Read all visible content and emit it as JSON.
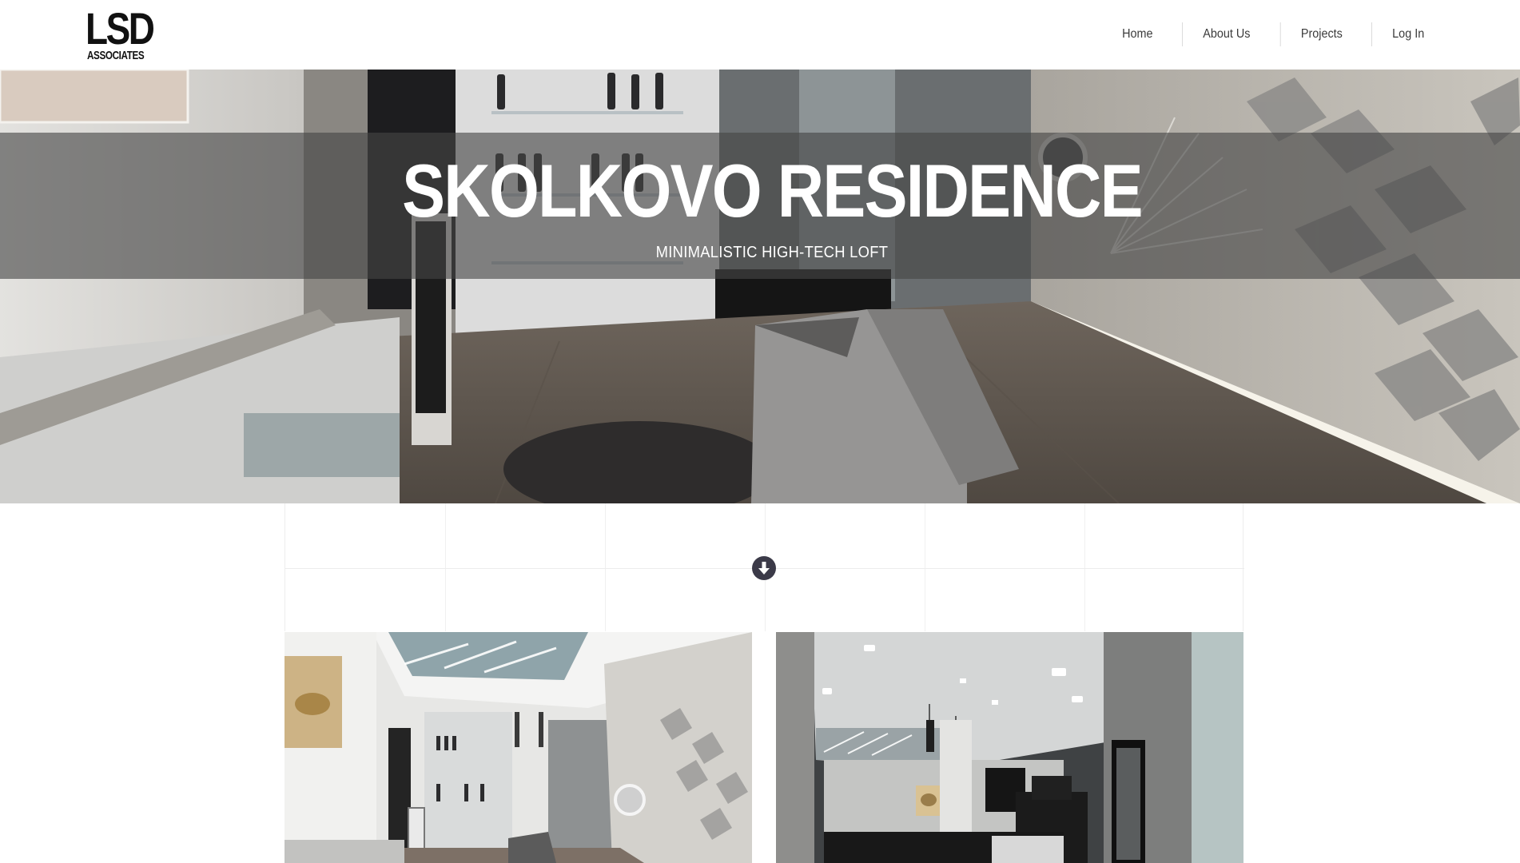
{
  "header": {
    "logo_main": "LSD",
    "logo_sub": "ASSOCIATES",
    "nav": [
      {
        "label": "Home"
      },
      {
        "label": "About Us"
      },
      {
        "label": "Projects"
      },
      {
        "label": "Log In"
      }
    ]
  },
  "hero": {
    "title": "SKOLKOVO RESIDENCE",
    "subtitle": "MINIMALISTIC HIGH-TECH LOFT"
  },
  "scroll": {
    "icon": "arrow-down-circle-icon"
  },
  "gallery": [
    {
      "icon": "interior-living-room-image"
    },
    {
      "icon": "interior-kitchen-image"
    }
  ],
  "colors": {
    "band": "#464646",
    "scroll_button": "#3b3a48",
    "text_dark": "#3a3a3a"
  }
}
